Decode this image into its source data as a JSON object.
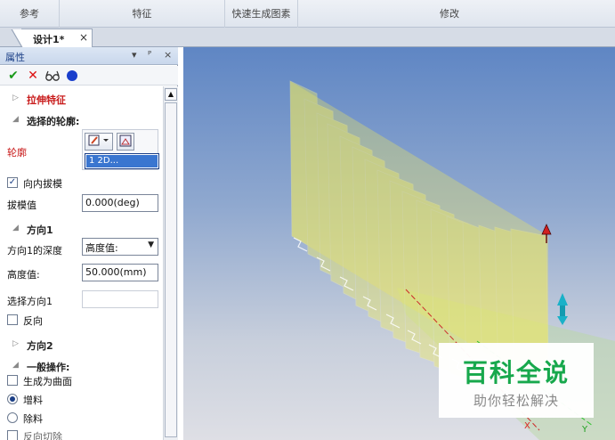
{
  "ribbon": {
    "groups": [
      "参考",
      "特征",
      "快速生成图素",
      "修改"
    ]
  },
  "document_tab": {
    "label": "设计1*",
    "close": "×"
  },
  "panel": {
    "title": "属性",
    "pin": "▼  ꟸ",
    "close": "×",
    "toolbar_icons": [
      "confirm-check-icon",
      "cancel-x-icon",
      "preview-glasses-icon",
      "blue-dot-icon"
    ],
    "sections": {
      "extrude_feature": "拉伸特征",
      "selected_contour": "选择的轮廓:",
      "direction1": "方向1",
      "direction2": "方向2",
      "general_ops": "一般操作:"
    },
    "contour_label": "轮廓",
    "contour_item": "1    2D...",
    "inward_draft": "向内拔模",
    "inward_draft_checked": true,
    "draft_value_label": "拔模值",
    "draft_value": "0.000(deg)",
    "dir1_depth_label": "方向1的深度",
    "dir1_depth_value": "高度值:",
    "height_label": "高度值:",
    "height_value": "50.000(mm)",
    "select_dir1_label": "选择方向1",
    "select_dir1_value": "",
    "reverse_label": "反向",
    "generate_surface_label": "生成为曲面",
    "add_material_label": "增料",
    "remove_material_label": "除料",
    "reverse_cut_label": "反向切除",
    "mode_selected": "增料"
  },
  "viewport": {
    "axis_labels": [
      "X",
      "Y"
    ]
  },
  "watermark": {
    "title": "百科全说",
    "subtitle": "助你轻松解决"
  },
  "colors": {
    "accent": "#1b3f86",
    "extrude_red": "#c81a1a",
    "watermark_green": "#17a84c"
  }
}
